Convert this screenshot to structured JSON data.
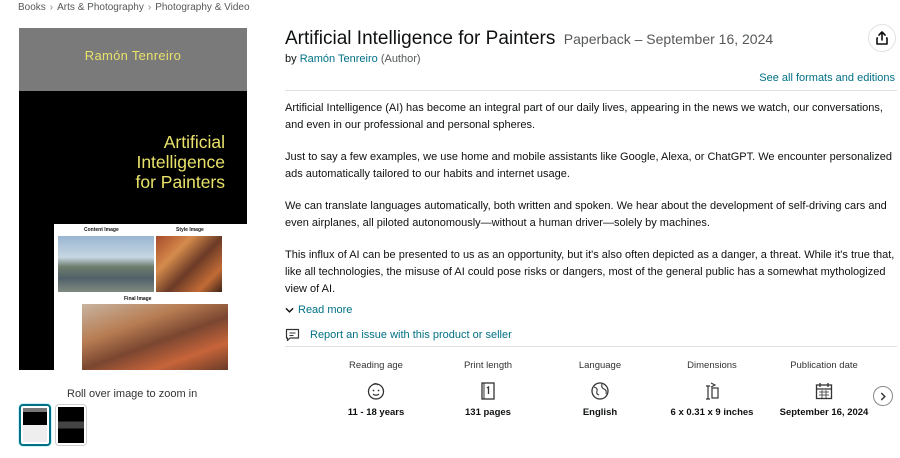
{
  "breadcrumb": {
    "items": [
      "Books",
      "Arts & Photography",
      "Photography & Video"
    ],
    "separator": "›"
  },
  "cover": {
    "author": "Ramón Tenreiro",
    "title_lines": [
      "Artificial",
      "Intelligence",
      "for Painters"
    ],
    "content_caption": "Content Image",
    "style_caption": "Style Image",
    "final_caption": "Final Image",
    "text_color": "#e9e26a"
  },
  "gallery": {
    "zoom_hint": "Roll over image to zoom in"
  },
  "product": {
    "title": "Artificial Intelligence for Painters",
    "format_date": "Paperback – September 16, 2024",
    "by": "by",
    "author": "Ramón Tenreiro",
    "author_role": "(Author)",
    "see_all_formats": "See all formats and editions",
    "share_icon": "share-icon"
  },
  "description": [
    "Artificial Intelligence (AI) has become an integral part of our daily lives, appearing in the news we watch, our conversations, and even in our professional and personal spheres.",
    "Just to say a few examples, we use home and mobile assistants like Google, Alexa, or ChatGPT. We encounter personalized ads automatically tailored to our habits and internet usage.",
    "We can translate languages automatically, both written and spoken. We hear about the development of self-driving cars and even airplanes, all piloted autonomously—without a human driver—solely by machines.",
    "This influx of AI can be presented to us as an opportunity, but it's also often depicted as a danger, a threat. While it's true that, like all technologies, the misuse of AI could pose risks or dangers, most of the general public has a somewhat mythologized view of AI."
  ],
  "actions": {
    "read_more": "Read more",
    "report_issue": "Report an issue with this product or seller"
  },
  "attributes": [
    {
      "label": "Reading age",
      "icon": "child-face-icon",
      "value": "11 - 18 years"
    },
    {
      "label": "Print length",
      "icon": "book-pages-icon",
      "value": "131 pages"
    },
    {
      "label": "Language",
      "icon": "globe-icon",
      "value": "English"
    },
    {
      "label": "Dimensions",
      "icon": "ruler-icon",
      "value": "6 x 0.31 x 9 inches"
    },
    {
      "label": "Publication date",
      "icon": "calendar-icon",
      "value": "September 16, 2024"
    }
  ],
  "colors": {
    "link": "#007185",
    "text": "#0f1111",
    "muted": "#565959"
  }
}
